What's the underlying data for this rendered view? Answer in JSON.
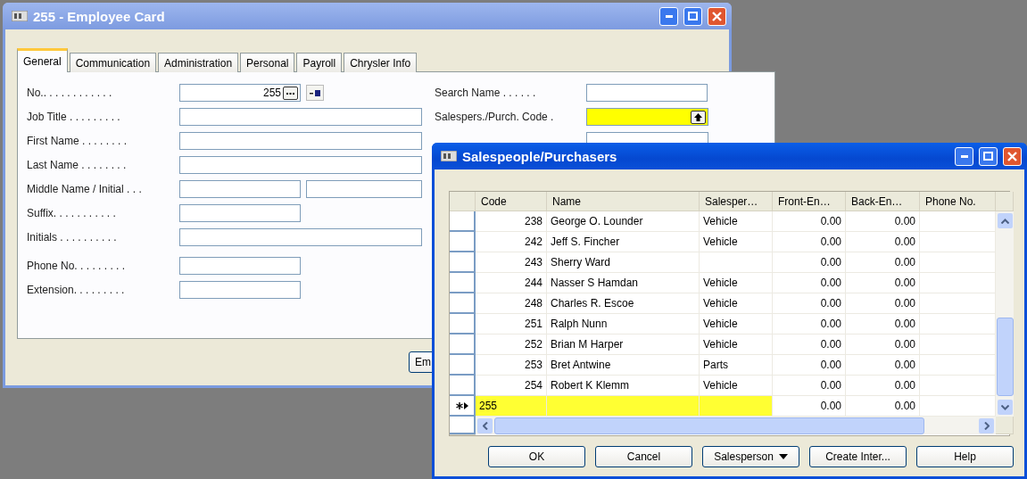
{
  "employee_card": {
    "title": "255 - Employee Card",
    "tabs": [
      {
        "label": "General",
        "selected": true
      },
      {
        "label": "Communication",
        "selected": false
      },
      {
        "label": "Administration",
        "selected": false
      },
      {
        "label": "Personal",
        "selected": false
      },
      {
        "label": "Payroll",
        "selected": false
      },
      {
        "label": "Chrysler Info",
        "selected": false
      }
    ],
    "left_groups": [
      [
        {
          "label": "No.. . . . . . . . . . . .",
          "kind": "number",
          "value": "255"
        },
        {
          "label": "Job Title . . . . . . . . .",
          "kind": "long"
        },
        {
          "label": "First Name . . . . . . . .",
          "kind": "long"
        },
        {
          "label": "Last Name . . . . . . . .",
          "kind": "long"
        },
        {
          "label": "Middle Name / Initial . . .",
          "kind": "pair"
        },
        {
          "label": "Suffix. . . . . . . . . . .",
          "kind": "short"
        },
        {
          "label": "Initials . . . . . . . . . .",
          "kind": "long"
        }
      ],
      [
        {
          "label": "Phone No. . . . . . . . .",
          "kind": "short"
        },
        {
          "label": "Extension. . . . . . . . .",
          "kind": "short"
        }
      ]
    ],
    "right_fields": [
      {
        "label": "Search Name . . . . . .",
        "kind": "short",
        "highlighted": false
      },
      {
        "label": "Salespers./Purch. Code .",
        "kind": "lookup",
        "highlighted": true
      }
    ],
    "footer_button": "Em"
  },
  "lookup_window": {
    "title": "Salespeople/Purchasers",
    "columns": [
      "Code",
      "Name",
      "Salesper…",
      "Front-En…",
      "Back-En…",
      "Phone No."
    ],
    "rows": [
      {
        "code": "238",
        "name": "George O. Lounder",
        "salesperson": "Vehicle",
        "front": "0.00",
        "back": "0.00",
        "selected": false
      },
      {
        "code": "242",
        "name": "Jeff S. Fincher",
        "salesperson": "Vehicle",
        "front": "0.00",
        "back": "0.00",
        "selected": false
      },
      {
        "code": "243",
        "name": "Sherry Ward",
        "salesperson": "",
        "front": "0.00",
        "back": "0.00",
        "selected": false
      },
      {
        "code": "244",
        "name": "Nasser S Hamdan",
        "salesperson": "Vehicle",
        "front": "0.00",
        "back": "0.00",
        "selected": false
      },
      {
        "code": "248",
        "name": "Charles R. Escoe",
        "salesperson": "Vehicle",
        "front": "0.00",
        "back": "0.00",
        "selected": false
      },
      {
        "code": "251",
        "name": "Ralph Nunn",
        "salesperson": "Vehicle",
        "front": "0.00",
        "back": "0.00",
        "selected": false
      },
      {
        "code": "252",
        "name": "Brian M Harper",
        "salesperson": "Vehicle",
        "front": "0.00",
        "back": "0.00",
        "selected": false
      },
      {
        "code": "253",
        "name": "Bret Antwine",
        "salesperson": "Parts",
        "front": "0.00",
        "back": "0.00",
        "selected": false
      },
      {
        "code": "254",
        "name": "Robert K Klemm",
        "salesperson": "Vehicle",
        "front": "0.00",
        "back": "0.00",
        "selected": false
      },
      {
        "code": "255",
        "name": "",
        "salesperson": "",
        "front": "0.00",
        "back": "0.00",
        "selected": true
      }
    ],
    "buttons": [
      {
        "label": "OK",
        "kind": "plain"
      },
      {
        "label": "Cancel",
        "kind": "plain"
      },
      {
        "label": "Salesperson",
        "kind": "menu"
      },
      {
        "label": "Create Inter...",
        "kind": "plain"
      },
      {
        "label": "Help",
        "kind": "plain"
      }
    ]
  }
}
